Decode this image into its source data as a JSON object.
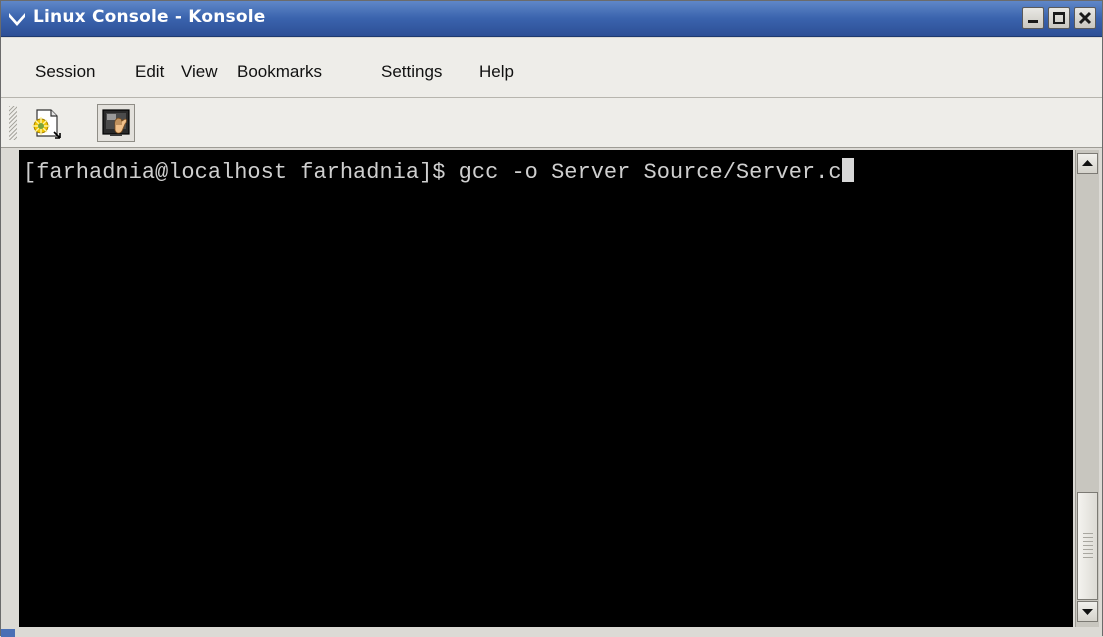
{
  "window": {
    "title": "Linux Console - Konsole"
  },
  "menubar": {
    "items": [
      "Session",
      "Edit",
      "View",
      "Bookmarks",
      "Settings",
      "Help"
    ]
  },
  "toolbar": {
    "buttons": [
      {
        "icon": "new-session-icon"
      },
      {
        "icon": "konsole-icon"
      }
    ]
  },
  "terminal": {
    "line": "[farhadnia@localhost farhadnia]$ gcc -o Server Source/Server.c",
    "background": "#000000",
    "foreground": "#cfcfcf"
  },
  "colors": {
    "titlebar": "#3a63ad",
    "chrome": "#eeede9"
  }
}
